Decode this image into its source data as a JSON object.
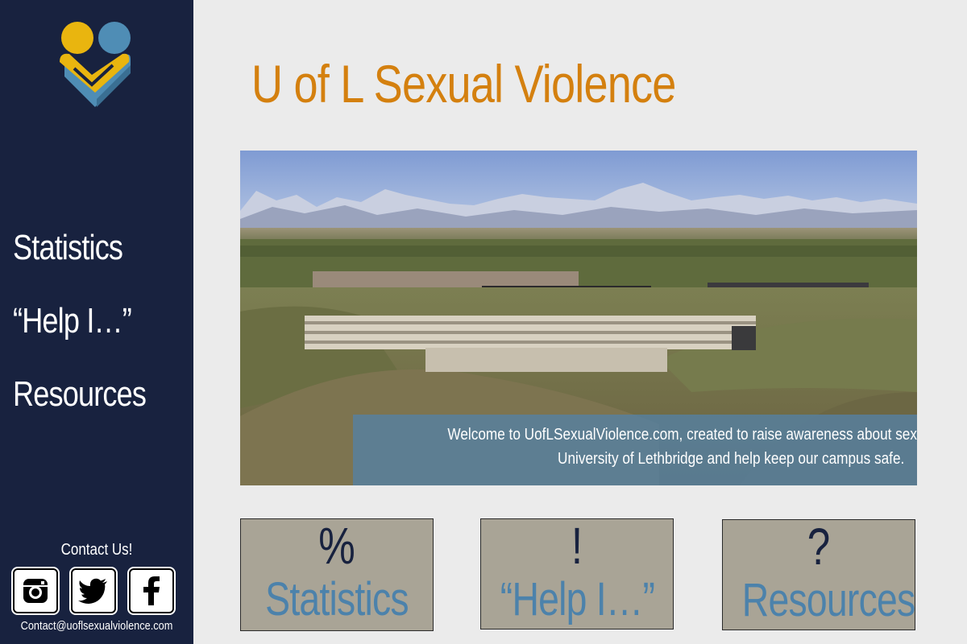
{
  "site": {
    "title": "U of L Sexual Violence",
    "logo_icon": "heart-people-logo-icon"
  },
  "nav": {
    "items": [
      {
        "label": "Statistics"
      },
      {
        "label": "“Help I…”"
      },
      {
        "label": "Resources"
      }
    ]
  },
  "contact": {
    "title": "Contact Us!",
    "email": "Contact@uoflsexualviolence.com",
    "social": [
      {
        "icon": "instagram-icon"
      },
      {
        "icon": "twitter-icon"
      },
      {
        "icon": "facebook-icon"
      }
    ]
  },
  "hero": {
    "caption_line1": "Welcome to UofLSexualViolence.com, created to raise awareness about sexual violence at the",
    "caption_line2": "University of Lethbridge and help keep our campus safe."
  },
  "cards": [
    {
      "symbol": "%",
      "label": "Statistics"
    },
    {
      "symbol": "!",
      "label": "“Help I…”"
    },
    {
      "symbol": "?",
      "label": "Resources"
    }
  ],
  "colors": {
    "sidebar": "#18223f",
    "title_orange": "#d4800f",
    "card_bg": "#a9a496",
    "card_label_blue": "#4c82ab",
    "logo_yellow": "#e9b50f",
    "logo_blue": "#4f8db5"
  }
}
